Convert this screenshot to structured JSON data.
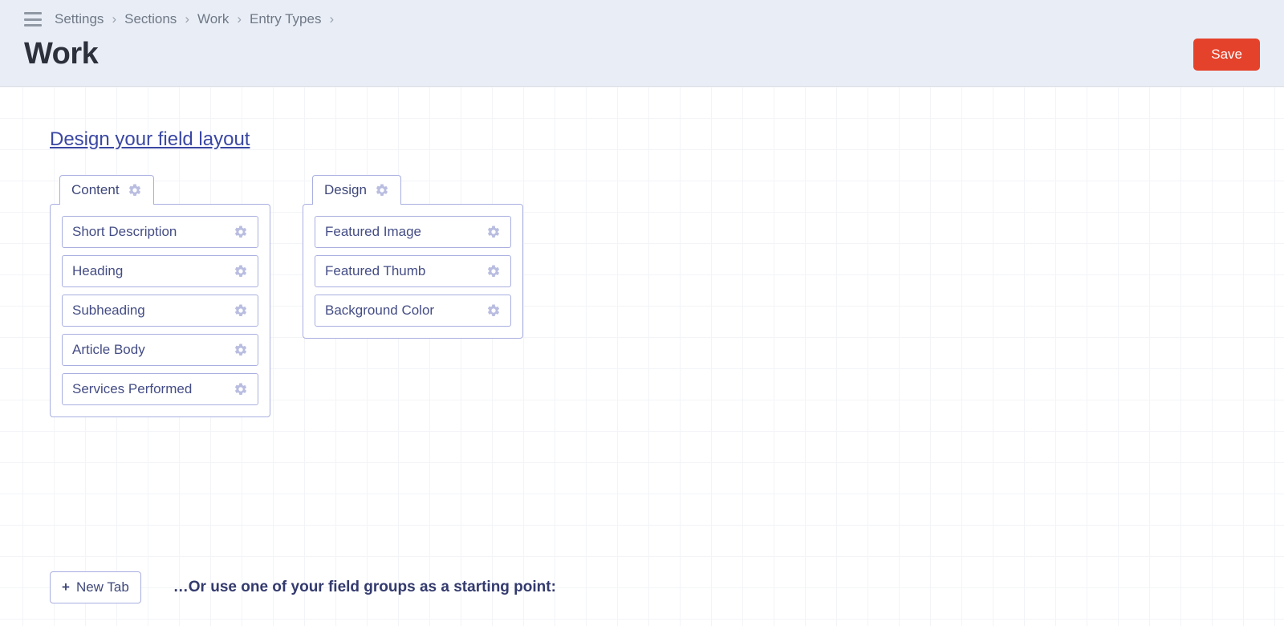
{
  "breadcrumb": {
    "items": [
      {
        "label": "Settings"
      },
      {
        "label": "Sections"
      },
      {
        "label": "Work"
      },
      {
        "label": "Entry Types"
      }
    ],
    "separator": "›"
  },
  "page_title": "Work",
  "save_button": "Save",
  "design_link": "Design your field layout",
  "tab_groups": [
    {
      "name": "Content",
      "fields": [
        "Short Description",
        "Heading",
        "Subheading",
        "Article Body",
        "Services Performed"
      ]
    },
    {
      "name": "Design",
      "fields": [
        "Featured Image",
        "Featured Thumb",
        "Background Color"
      ]
    }
  ],
  "new_tab_button": "New Tab",
  "starting_point_text": "…Or use one of your field groups as a starting point:"
}
